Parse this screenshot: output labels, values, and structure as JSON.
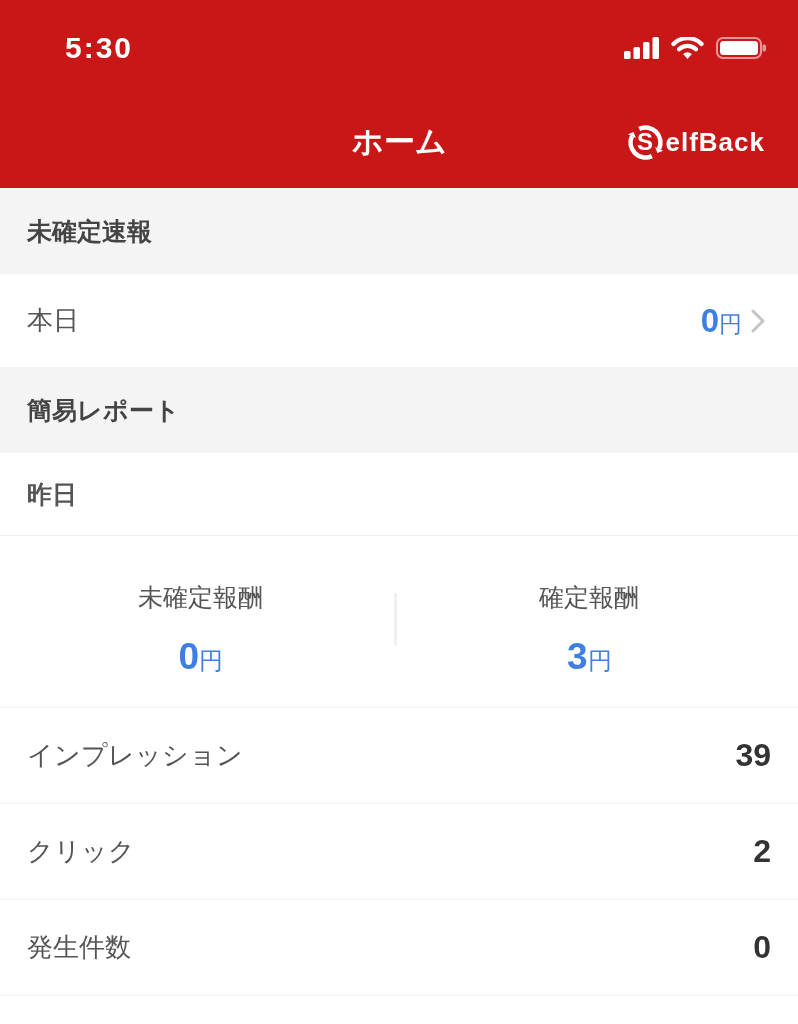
{
  "status_bar": {
    "time": "5:30"
  },
  "nav_bar": {
    "title": "ホーム",
    "logo": {
      "mark": "S",
      "wordmark": "elfBack"
    }
  },
  "sections": [
    {
      "title": "未確定速報",
      "rows": [
        {
          "kind": "link",
          "label": "本日",
          "value": "0",
          "unit": "円"
        }
      ]
    },
    {
      "title": "簡易レポート",
      "rows": [
        {
          "kind": "subheading",
          "label": "昨日"
        },
        {
          "kind": "summary",
          "items": [
            {
              "label": "未確定報酬",
              "value": "0",
              "unit": "円"
            },
            {
              "label": "確定報酬",
              "value": "3",
              "unit": "円"
            }
          ]
        },
        {
          "kind": "metric",
          "label": "インプレッション",
          "value": "39"
        },
        {
          "kind": "metric",
          "label": "クリック",
          "value": "2"
        },
        {
          "kind": "metric",
          "label": "発生件数",
          "value": "0"
        }
      ]
    }
  ]
}
